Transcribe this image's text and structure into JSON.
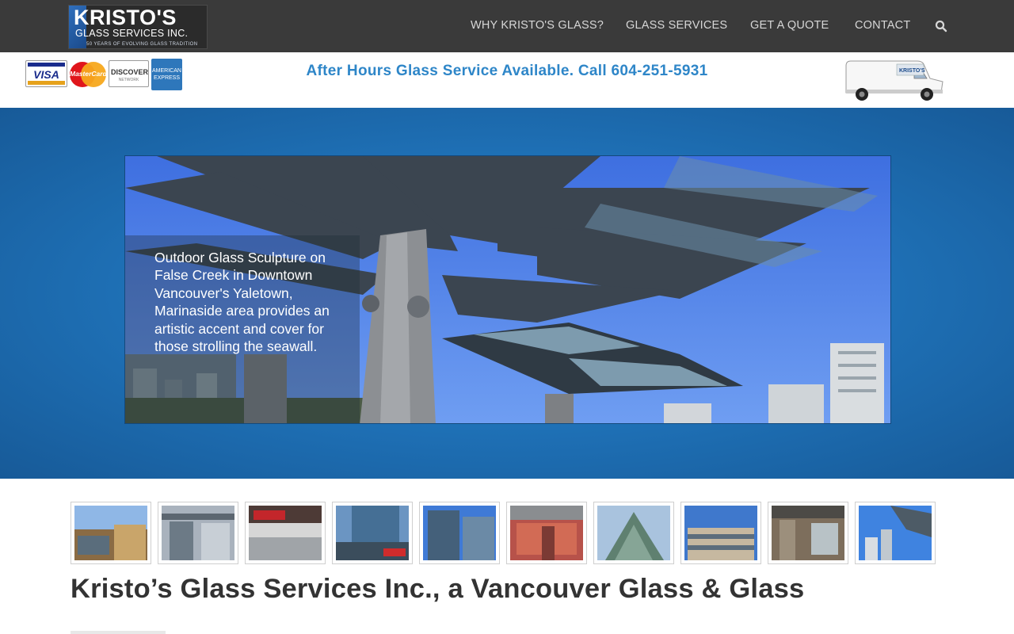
{
  "header": {
    "logo": {
      "brand_line1": "KRISTO'S",
      "brand_line2": "GLASS SERVICES INC.",
      "tagline": "50 YEARS OF EVOLVING GLASS TRADITION"
    },
    "nav": [
      {
        "label": "WHY KRISTO'S GLASS?"
      },
      {
        "label": "GLASS SERVICES"
      },
      {
        "label": "GET A QUOTE"
      },
      {
        "label": "CONTACT"
      }
    ],
    "search_icon": "search-icon"
  },
  "infobar": {
    "cards": {
      "visa": "VISA",
      "mastercard": "MasterCard",
      "discover": "DISCOVER",
      "discover_sub": "NETWORK",
      "amex": "AMERICAN EXPRESS"
    },
    "after_hours": "After Hours Glass Service Available. Call 604-251-5931",
    "van_label": "KRISTO'S"
  },
  "hero": {
    "caption": "Outdoor Glass Sculpture on False Creek in Downtown Vancouver's Yaletown, Marinaside area provides an artistic accent and cover for those strolling the seawall."
  },
  "thumbnails": [
    {
      "name": "thumb-1"
    },
    {
      "name": "thumb-2"
    },
    {
      "name": "thumb-3"
    },
    {
      "name": "thumb-4"
    },
    {
      "name": "thumb-5"
    },
    {
      "name": "thumb-6"
    },
    {
      "name": "thumb-7"
    },
    {
      "name": "thumb-8"
    },
    {
      "name": "thumb-9"
    },
    {
      "name": "thumb-10"
    }
  ],
  "main": {
    "title": "Kristo’s Glass Services Inc., a Vancouver Glass & Glass"
  },
  "colors": {
    "navbar": "#3a3a3a",
    "accent_blue": "#2e86c8",
    "hero_blue": "#1e6fb4",
    "title_text": "#333333"
  }
}
